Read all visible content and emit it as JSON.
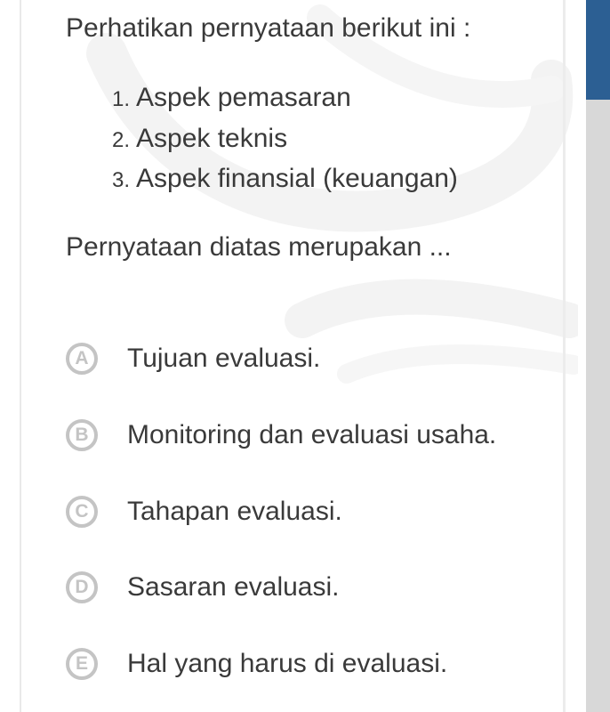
{
  "question": {
    "intro": "Perhatikan pernyataan berikut ini :",
    "items": [
      {
        "num": "1.",
        "text": "Aspek pemasaran"
      },
      {
        "num": "2.",
        "text": "Aspek teknis"
      },
      {
        "num": "3.",
        "text": "Aspek finansial (keuangan)"
      }
    ],
    "prompt": "Pernyataan diatas merupakan ..."
  },
  "options": [
    {
      "letter": "A",
      "text": "Tujuan evaluasi."
    },
    {
      "letter": "B",
      "text": "Monitoring dan evaluasi usaha."
    },
    {
      "letter": "C",
      "text": "Tahapan evaluasi."
    },
    {
      "letter": "D",
      "text": "Sasaran evaluasi."
    },
    {
      "letter": "E",
      "text": "Hal yang harus di evaluasi."
    }
  ],
  "colors": {
    "text": "#3a3a3a",
    "option_circle": "#c4c4c4",
    "scrollbar_thumb": "#2c5f93",
    "scrollbar_track": "#d8d8d8"
  }
}
